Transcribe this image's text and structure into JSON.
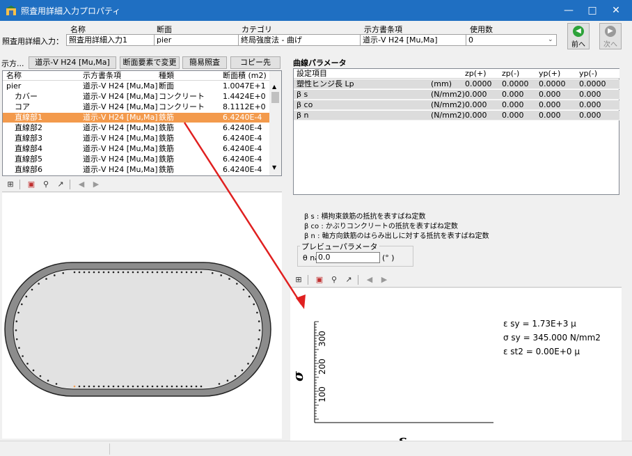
{
  "window": {
    "title": "照査用詳細入力プロパティ",
    "controls": [
      "minimize-icon",
      "maximize-icon",
      "close-icon"
    ]
  },
  "header": {
    "row_label": "照査用詳細入力：",
    "columns": [
      "名称",
      "断面",
      "カテゴリ",
      "示方書条項",
      "使用数"
    ],
    "values": [
      "照査用詳細入力1",
      "pier",
      "終局強度法 - 曲げ",
      "道示-V H24 [Mu,Ma]",
      "0"
    ],
    "prev_label": "前へ",
    "next_label": "次へ"
  },
  "toolbar": {
    "spec_label": "示方...",
    "spec_value": "道示-V H24 [Mu,Ma]",
    "change_section": "断面要素で変更",
    "simple_check": "簡易照査",
    "copy_to": "コピー先"
  },
  "element_list": {
    "headers": [
      "名称",
      "示方書条項",
      "種類",
      "断面積 (m2)"
    ],
    "rows": [
      {
        "name": "pier",
        "spec": "道示-V H24 [Mu,Ma]",
        "type": "断面",
        "area": "1.0047E+1"
      },
      {
        "name": "カバー",
        "spec": "道示-V H24 [Mu,Ma]",
        "type": "コンクリート",
        "area": "1.4424E+0"
      },
      {
        "name": "コア",
        "spec": "道示-V H24 [Mu,Ma]",
        "type": "コンクリート",
        "area": "8.1112E+0"
      },
      {
        "name": "直線部1",
        "spec": "道示-V H24 [Mu,Ma]",
        "type": "鉄筋",
        "area": "6.4240E-4"
      },
      {
        "name": "直線部2",
        "spec": "道示-V H24 [Mu,Ma]",
        "type": "鉄筋",
        "area": "6.4240E-4"
      },
      {
        "name": "直線部3",
        "spec": "道示-V H24 [Mu,Ma]",
        "type": "鉄筋",
        "area": "6.4240E-4"
      },
      {
        "name": "直線部4",
        "spec": "道示-V H24 [Mu,Ma]",
        "type": "鉄筋",
        "area": "6.4240E-4"
      },
      {
        "name": "直線部5",
        "spec": "道示-V H24 [Mu,Ma]",
        "type": "鉄筋",
        "area": "6.4240E-4"
      },
      {
        "name": "直線部6",
        "spec": "道示-V H24 [Mu,Ma]",
        "type": "鉄筋",
        "area": "6.4240E-4"
      }
    ],
    "selected_index": 3
  },
  "curve_params": {
    "title": "曲線パラメータ",
    "headers": [
      "設定項目",
      "",
      "zp(+)",
      "zp(-)",
      "yp(+)",
      "yp(-)"
    ],
    "rows": [
      {
        "item": "塑性ヒンジ長 Lp",
        "unit": "(mm)",
        "v": [
          "0.0000",
          "0.0000",
          "0.0000",
          "0.0000"
        ]
      },
      {
        "item": "β s",
        "unit": "(N/mm2)",
        "v": [
          "0.000",
          "0.000",
          "0.000",
          "0.000"
        ]
      },
      {
        "item": "β co",
        "unit": "(N/mm2)",
        "v": [
          "0.000",
          "0.000",
          "0.000",
          "0.000"
        ]
      },
      {
        "item": "β n",
        "unit": "(N/mm2)",
        "v": [
          "0.000",
          "0.000",
          "0.000",
          "0.000"
        ]
      }
    ]
  },
  "notes": [
    "β s : 横拘束鉄筋の抵抗を表すばね定数",
    "β co : かぶりコンクリートの抵抗を表すばね定数",
    "β n : 軸方向鉄筋のはらみ出しに対する抵抗を表すばね定数"
  ],
  "preview": {
    "group_label": "プレビューパラメータ",
    "theta_label": "θ na",
    "theta_value": "0.0",
    "unit": "(° )"
  },
  "graph": {
    "eps_sy": "ε sy = 1.73E+3 μ",
    "sigma_sy": "σ sy = 345.000 N/mm2",
    "eps_st2": "ε st2 = 0.00E+0 μ",
    "ylabel": "σ",
    "xlabel": "ε",
    "ticks": [
      "300",
      "200",
      "100"
    ]
  },
  "colors": {
    "titlebar": "#1f6fc2",
    "selection": "#f39a4c",
    "arrow": "#e02020"
  }
}
